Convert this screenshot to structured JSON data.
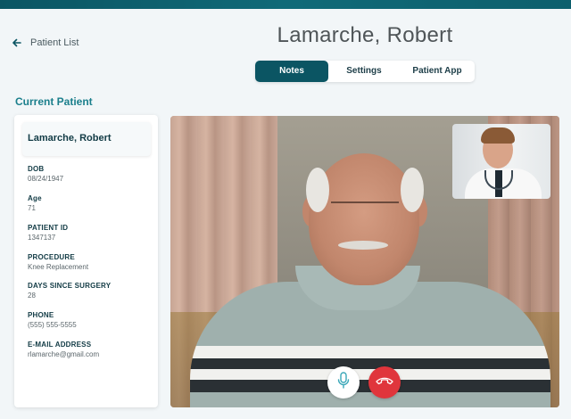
{
  "header": {
    "back_label": "Patient List",
    "patient_title": "Lamarche, Robert"
  },
  "tabs": [
    {
      "label": "Notes",
      "active": true
    },
    {
      "label": "Settings",
      "active": false
    },
    {
      "label": "Patient App",
      "active": false
    }
  ],
  "current_patient": {
    "section_label": "Current Patient",
    "name": "Lamarche, Robert",
    "fields": [
      {
        "label": "DOB",
        "value": "08/24/1947"
      },
      {
        "label": "Age",
        "value": "71"
      },
      {
        "label": "PATIENT ID",
        "value": "1347137"
      },
      {
        "label": "PROCEDURE",
        "value": "Knee Replacement"
      },
      {
        "label": "DAYS SINCE SURGERY",
        "value": "28"
      },
      {
        "label": "PHONE",
        "value": "(555) 555-5555"
      },
      {
        "label": "E-MAIL ADDRESS",
        "value": "rlamarche@gmail.com"
      }
    ]
  },
  "video_call": {
    "controls": [
      "microphone-icon",
      "end-call-icon"
    ],
    "accent_color": "#0b5563",
    "end_call_color": "#e0353c",
    "mic_color": "#3aa7b8"
  }
}
